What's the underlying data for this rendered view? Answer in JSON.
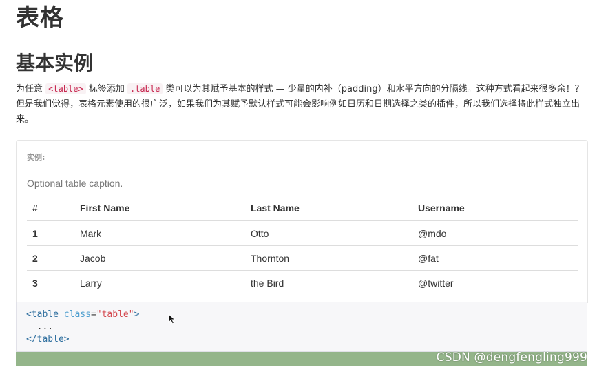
{
  "page_title": "表格",
  "section_title": "基本实例",
  "description": {
    "part1": "为任意 ",
    "code1": "<table>",
    "part2": " 标签添加 ",
    "code2": ".table",
    "part3": " 类可以为其赋予基本的样式 — 少量的内补（padding）和水平方向的分隔线。这种方式看起来很多余！？但是我们觉得，表格元素使用的很广泛，如果我们为其赋予默认样式可能会影响例如日历和日期选择之类的插件，所以我们选择将此样式独立出来。"
  },
  "example": {
    "label": "实例:",
    "caption": "Optional table caption.",
    "headers": [
      "#",
      "First Name",
      "Last Name",
      "Username"
    ],
    "rows": [
      [
        "1",
        "Mark",
        "Otto",
        "@mdo"
      ],
      [
        "2",
        "Jacob",
        "Thornton",
        "@fat"
      ],
      [
        "3",
        "Larry",
        "the Bird",
        "@twitter"
      ]
    ]
  },
  "code": {
    "open_tag": "<table",
    "attr": "class",
    "eq": "=",
    "value": "\"table\"",
    "close_bracket": ">",
    "ellipsis": "  ...",
    "close_tag": "</table>"
  },
  "watermark": "CSDN @dengfengling999",
  "colors": {
    "code_red": "#c7254e",
    "bar_green": "#94b58a"
  }
}
